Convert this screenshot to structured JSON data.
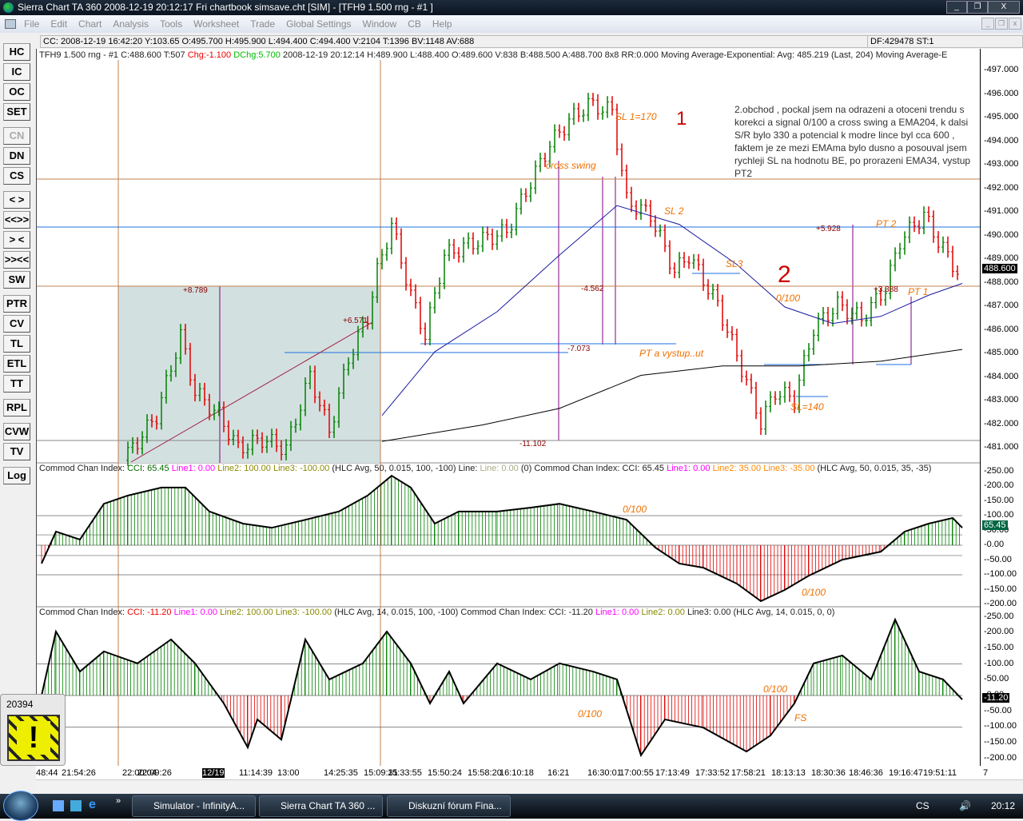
{
  "window": {
    "title": "Sierra Chart TA 360  2008-12-19  20:12:17  Fri   chartbook simsave.cht [SIM] - [TFH9  1.500 rng - #1 ]",
    "min": "_",
    "restore": "❐",
    "close": "X"
  },
  "menu": [
    "File",
    "Edit",
    "Chart",
    "Analysis",
    "Tools",
    "Worksheet",
    "Trade",
    "Global Settings",
    "Window",
    "CB",
    "Help"
  ],
  "infobar": {
    "text": "CC: 2008-12-19  16:42:20  Y:103.65  O:495.700  H:495.900  L:494.400  C:494.400  V:2104  T:1396  BV:1148  AV:688",
    "df": "DF:429478  ST:1"
  },
  "toolbar": [
    "HC",
    "IC",
    "OC",
    "SET",
    "CN",
    "DN",
    "CS",
    "< >",
    "<<>>",
    "> <",
    ">><<",
    "SW",
    "PTR",
    "CV",
    "TL",
    "ETL",
    "TT",
    "RPL",
    "CVW",
    "TV",
    "Log"
  ],
  "price_header": {
    "symbol": "TFH9  1.500 rng - #1  C:488.600  T:507",
    "chg": "Chg:-1.100",
    "dchg": "DChg:5.700",
    "rest": "2008-12-19  20:12:14  H:489.900  L:488.400  O:489.600  V:838  B:488.500  A:488.700  8x8  RR:0.000  Moving Average-Exponential:  Avg: 485.219  (Last, 204)  Moving Average-E"
  },
  "cci1_header": {
    "name": "Commod Chan Index:",
    "cci": "CCI: 65.45",
    "l1": "Line1: 0.00",
    "l2": "Line2: 100.00",
    "l3": "Line3: -100.00",
    "params": "(HLC Avg, 50, 0.015, 100, -100)",
    "line": "Line:",
    "linev": "Line: 0.00",
    "zero": "(0)",
    "name2": "Commod Chan Index:",
    "cci2": "CCI: 65.45",
    "l1b": "Line1: 0.00",
    "l2b": "Line2: 35.00",
    "l3b": "Line3: -35.00",
    "params2": "(HLC Avg, 50, 0.015, 35, -35)"
  },
  "cci2_header": {
    "name": "Commod Chan Index:",
    "cci": "CCI: -11.20",
    "l1": "Line1: 0.00",
    "l2": "Line2: 100.00",
    "l3": "Line3: -100.00",
    "params": "(HLC Avg, 14, 0.015, 100, -100)",
    "name2": "Commod Chan Index:",
    "cci2": "CCI: -11.20",
    "l1b": "Line1: 0.00",
    "l2b": "Line2: 0.00",
    "l3b": "Line3: 0.00",
    "params2": "(HLC Avg, 14, 0.015, 0, 0)"
  },
  "price_axis": [
    "497.000",
    "496.000",
    "495.000",
    "494.000",
    "493.000",
    "492.000",
    "491.000",
    "490.000",
    "489.000",
    "488.000",
    "487.000",
    "486.000",
    "485.000",
    "484.000",
    "483.000",
    "482.000",
    "481.000"
  ],
  "price_last": "488.600",
  "cci_axis": [
    "250.00",
    "200.00",
    "150.00",
    "100.00",
    "50.00",
    "0.00",
    "-50.00",
    "-100.00",
    "-150.00",
    "-200.00"
  ],
  "cci1_last": "65.45",
  "cci2_last": "-11.20",
  "annotations": {
    "sl1": "SL 1=170",
    "n1": "1",
    "cross": "cross swing",
    "sl2": "SL 2",
    "sl3": "SL3",
    "n2": "2",
    "pt_vystup": "PT a vystup..ut",
    "pt2": "PT 2",
    "pt1": "PT 1",
    "sl140": "SL=140",
    "z1": "0/100",
    "z2": "0/100",
    "z3": "0/100",
    "z4": "0/100",
    "z5": "0/100",
    "fs": "FS",
    "m1": "+8.789",
    "m2": "+6.571",
    "m3": "-4.562",
    "m4": "-7.073",
    "m5": "-11.102",
    "m6": "+5.928",
    "m7": "+3.388"
  },
  "note": "2.obchod , pockal jsem na odrazeni a otoceni trendu s korekci a signal 0/100 a cross swing a EMA204, k dalsi S/R bylo 330 a potencial k modre lince byl cca 600 , faktem je ze mezi EMAma bylo dusno a posouval jsem rychleji SL na hodnotu BE, po prorazeni EMA34, vystup PT2",
  "time_axis": [
    "48:44",
    "21:54:26",
    "22:00:04",
    "22:09:26",
    "12/19",
    "11:14:39",
    "13:00",
    "14:25:35",
    "15:09:31",
    "15:33:55",
    "15:50:24",
    "15:58:20",
    "16:10:18",
    "16:21",
    "16:30:01",
    "17:00:55",
    "17:13:49",
    "17:33:52",
    "17:58:21",
    "18:13:13",
    "18:30:36",
    "18:46:36",
    "19:16:47",
    "19:51:11",
    "7"
  ],
  "alert": {
    "number": "20394",
    "icon": "exclamation-icon"
  },
  "taskbar": {
    "items": [
      "Simulator - InfinityA...",
      "Sierra Chart TA 360  ...",
      "Diskuzní fórum Fina..."
    ],
    "lang": "CS",
    "clock": "20:12"
  },
  "colors": {
    "up": "#008000",
    "down": "#e00000",
    "ema34": "#1a1aa0",
    "ema204": "#000000",
    "annotation": "#f07000"
  },
  "chart_data": {
    "type": "line",
    "price": {
      "ylim": [
        480.5,
        497.5
      ],
      "x": [
        19,
        26,
        31,
        34,
        39,
        43,
        48,
        53,
        58,
        62,
        66,
        70,
        72,
        75,
        79,
        82,
        86,
        93,
        99,
        103,
        108,
        112,
        116,
        121,
        124,
        129,
        134,
        137,
        143,
        148,
        152,
        155,
        159,
        163,
        168,
        173,
        178,
        181,
        186,
        189,
        193
      ],
      "close": [
        480.5,
        482.4,
        485.8,
        483.4,
        482.4,
        481,
        481.4,
        481,
        484.1,
        481.7,
        484.8,
        486.6,
        488.5,
        490.5,
        487.5,
        485.8,
        489.2,
        489.8,
        490.2,
        491.9,
        493.9,
        494.9,
        495.6,
        495.3,
        491.5,
        490.9,
        488.5,
        489.2,
        487.1,
        484.4,
        482.1,
        483.4,
        483.1,
        486.1,
        487.1,
        486.5,
        487.8,
        489.8,
        490.9,
        489.8,
        488.5
      ]
    },
    "ema34": {
      "x": [
        72,
        83,
        96,
        109,
        121,
        134,
        146,
        156,
        166,
        176,
        186,
        193
      ],
      "y": [
        482.4,
        485.1,
        486.8,
        489.2,
        491.3,
        490.5,
        488.8,
        487,
        486.3,
        486.6,
        487.5,
        488
      ]
    },
    "ema204": {
      "x": [
        72,
        93,
        109,
        126,
        143,
        159,
        176,
        193
      ],
      "y": [
        481.3,
        482,
        482.7,
        484.1,
        484.5,
        484.5,
        484.7,
        485.2
      ]
    },
    "cci50": {
      "x": [
        1,
        4,
        9,
        14,
        19,
        26,
        31,
        36,
        43,
        49,
        56,
        63,
        69,
        74,
        78,
        83,
        88,
        96,
        103,
        109,
        116,
        123,
        129,
        134,
        139,
        146,
        151,
        156,
        161,
        168,
        176,
        181,
        186,
        191,
        193
      ],
      "y": [
        -62,
        46,
        19,
        140,
        168,
        195,
        195,
        114,
        73,
        59,
        86,
        114,
        168,
        235,
        195,
        73,
        114,
        114,
        127,
        140,
        114,
        86,
        -8,
        -62,
        -76,
        -130,
        -189,
        -151,
        -103,
        -49,
        -22,
        46,
        73,
        92,
        59
      ]
    },
    "cci14": {
      "x": [
        1,
        4,
        9,
        14,
        21,
        28,
        33,
        39,
        44,
        46,
        51,
        56,
        61,
        68,
        73,
        78,
        82,
        86,
        89,
        96,
        103,
        109,
        116,
        121,
        126,
        131,
        139,
        148,
        153,
        158,
        162,
        168,
        174,
        179,
        184,
        189,
        193
      ],
      "y": [
        0,
        203,
        76,
        140,
        102,
        178,
        102,
        -25,
        -165,
        -76,
        -140,
        178,
        51,
        102,
        203,
        102,
        -25,
        76,
        -25,
        102,
        51,
        102,
        76,
        51,
        -190,
        -76,
        -102,
        -178,
        -127,
        -25,
        102,
        127,
        51,
        241,
        76,
        51,
        -13
      ]
    }
  }
}
